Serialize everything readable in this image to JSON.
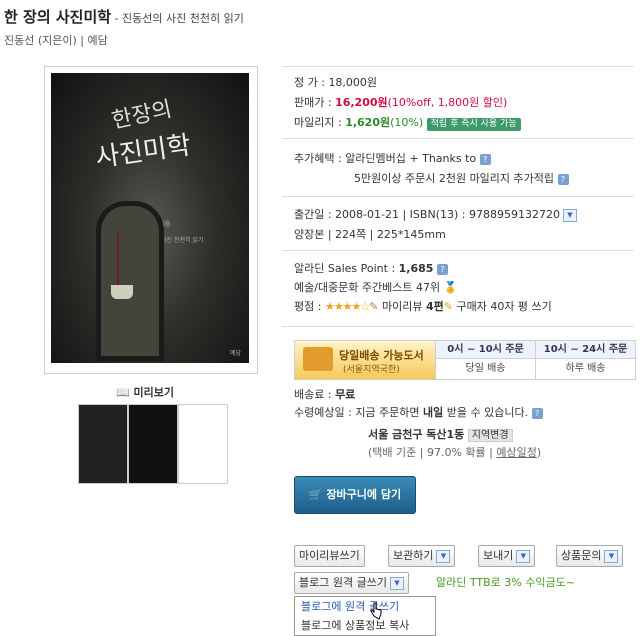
{
  "header": {
    "title": "한 장의 사진미학",
    "subtitle": " - 진동선의 사진 천천히 읽기",
    "author_line": "진동선 (지은이) | 예담"
  },
  "cover": {
    "title_line1": "한장의",
    "title_line2": "사진미학",
    "small1": "진동선 지음",
    "small2": "사진 천천히 읽기",
    "publisher": "예담"
  },
  "preview": {
    "label": "미리보기"
  },
  "price": {
    "list_label": "정    가 : ",
    "list_value": "18,000원",
    "sale_label": "판매가 : ",
    "sale_value": "16,200원",
    "sale_pct": "(10%off, ",
    "sale_discount": "1,800원",
    "sale_suffix": " 할인)",
    "mileage_label": "마일리지 : ",
    "mileage_value": "1,620원",
    "mileage_pct": "(10%)",
    "mileage_badge": "적립 후 즉시 사용 가능"
  },
  "benefits": {
    "label": "추가혜택 : ",
    "line1": "알라딘멤버십 + Thanks to",
    "line2": "5만원이상 주문시 2천원 마일리지 추가적립"
  },
  "info": {
    "pubdate": "출간일 : 2008-01-21 | ISBN(13) : 9788959132720",
    "format": "양장본 | 224쪽 | 225*145mm"
  },
  "sales": {
    "point_label": "알라딘 Sales Point : ",
    "point_value": "1,685",
    "best": "예술/대중문화 주간베스트 47위",
    "rating_label": "평점 : ",
    "stars": "★★★★☆",
    "myreview": " 마이리뷰 ",
    "myreview_count": "4편",
    "buyer": " 구매자 40자 평 쓰기"
  },
  "delivery": {
    "title": "당일배송 가능도서",
    "subtitle": "(서울지역국한)",
    "col1_head": "0시 ~ 10시 주문",
    "col1_body": "당일 배송",
    "col2_head": "10시 ~ 24시 주문",
    "col2_body": "하루 배송"
  },
  "shipping": {
    "fee_label": "배송료 : ",
    "fee_value": "무료",
    "expected_label": "수령예상일 : ",
    "expected_text1": "지금 주문하면 ",
    "expected_bold": "내일",
    "expected_text2": " 받을 수 있습니다.",
    "region": "서울 금천구 독산1동",
    "region_btn": "지역변경",
    "basis": "(택배 기준 | 97.0% 확률 | ",
    "basis_link": "예상일정",
    "basis_end": ")"
  },
  "actions": {
    "cart": "장바구니에 담기",
    "myreview_write": "마이리뷰쓰기",
    "save": "보관하기",
    "send": "보내기",
    "inquiry": "상품문의",
    "blog_remote": "블로그 원격 글쓰기",
    "ttb": "알라딘 TTB로 3% 수익금도~",
    "menu_item1": "블로그에 원격 글쓰기",
    "menu_item2": "블로그에 상품정보 복사"
  }
}
